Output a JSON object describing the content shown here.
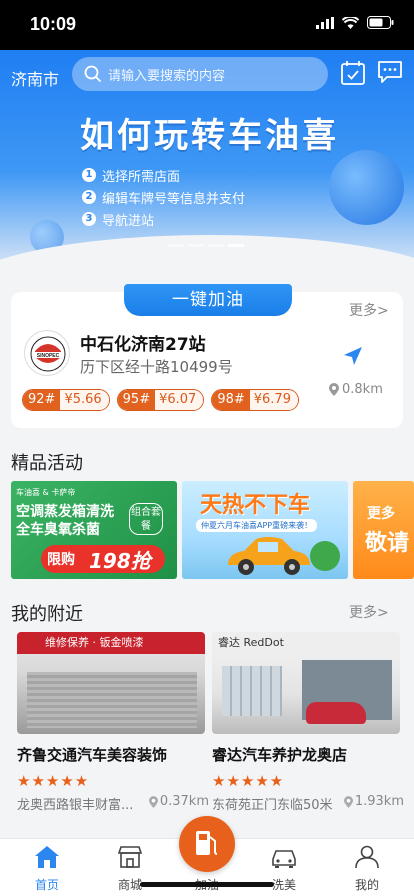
{
  "status_bar": {
    "time": "10:09"
  },
  "header": {
    "city": "济南市",
    "search_placeholder": "请输入要搜索的内容"
  },
  "banner": {
    "title": "如何玩转车油喜",
    "steps": [
      {
        "num": "1",
        "text": "选择所需店面"
      },
      {
        "num": "2",
        "text": "编辑车牌号等信息并支付"
      },
      {
        "num": "3",
        "text": "导航进站"
      }
    ],
    "page_count": 4,
    "active_page": 4
  },
  "refuel": {
    "tab_label": "一键加油",
    "more_label": "更多>",
    "station": {
      "name": "中石化济南27站",
      "address": "历下区经十路10499号",
      "distance": "0.8km",
      "logo_text": "SINOPEC"
    },
    "prices": [
      {
        "grade": "92#",
        "price": "¥5.66"
      },
      {
        "grade": "95#",
        "price": "¥6.07"
      },
      {
        "grade": "98#",
        "price": "¥6.79"
      }
    ]
  },
  "activities": {
    "title": "精品活动",
    "items": [
      {
        "brand": "车油喜 & 卡萨帝",
        "headline1": "空调蒸发箱清洗",
        "headline2": "全车臭氧杀菌",
        "badge": "组合套餐",
        "promo": "限购",
        "price": "198抢"
      },
      {
        "headline": "天热不下车",
        "sub": "仲夏六月车油喜APP重磅来袭！"
      },
      {
        "text1": "更多",
        "text2": "敬请"
      }
    ]
  },
  "nearby": {
    "title": "我的附近",
    "more_label": "更多>",
    "shops": [
      {
        "name": "齐鲁交通汽车美容装饰",
        "stars": "★★★★★",
        "address": "龙奥西路银丰财富...",
        "distance": "0.37km",
        "sign": "维修保养 · 钣金喷漆"
      },
      {
        "name": "睿达汽车养护龙奥店",
        "stars": "★★★★★",
        "address": "东荷苑正门东临50米",
        "distance": "1.93km",
        "sign": "睿达 RedDot"
      }
    ]
  },
  "tabbar": {
    "items": [
      {
        "label": "首页",
        "icon": "home-icon"
      },
      {
        "label": "商城",
        "icon": "store-icon"
      },
      {
        "label": "加油",
        "icon": "fuel-pump-icon"
      },
      {
        "label": "洗美",
        "icon": "car-icon"
      },
      {
        "label": "我的",
        "icon": "profile-icon"
      }
    ],
    "active": "首页"
  },
  "colors": {
    "accent_blue": "#2b86f0",
    "accent_orange": "#e8611c"
  }
}
